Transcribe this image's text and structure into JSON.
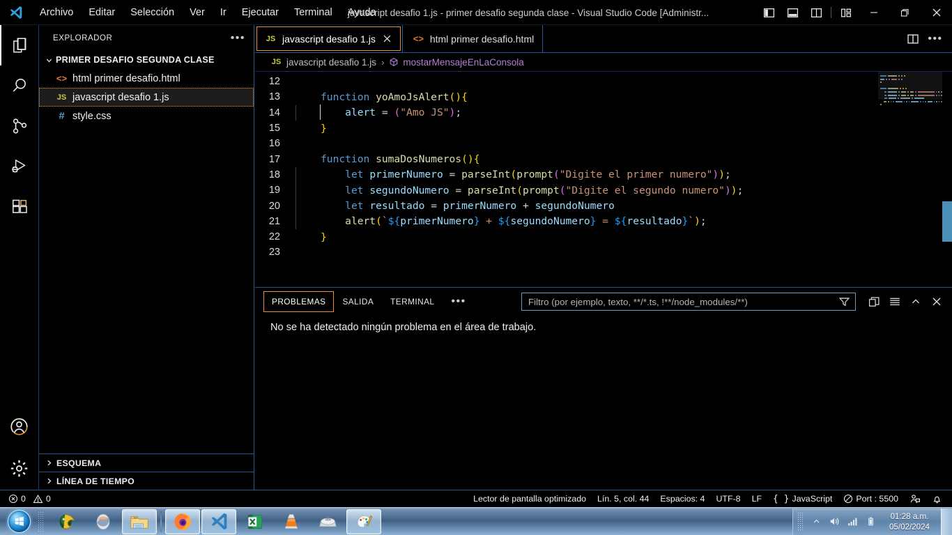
{
  "titlebar": {
    "logo_icon": "vscode-logo-icon",
    "menus": [
      "Archivo",
      "Editar",
      "Selección",
      "Ver",
      "Ir",
      "Ejecutar",
      "Terminal",
      "Ayuda"
    ],
    "window_title": "javascript desafio 1.js - primer desafio segunda clase - Visual Studio Code [Administr...",
    "layout_buttons": [
      {
        "name": "toggle-primary-sidebar-icon"
      },
      {
        "name": "toggle-panel-icon"
      },
      {
        "name": "toggle-secondary-sidebar-icon"
      },
      {
        "name": "customize-layout-icon"
      }
    ],
    "window_controls": [
      {
        "name": "minimize-button",
        "glyph": "–"
      },
      {
        "name": "maximize-button",
        "glyph": "❐"
      },
      {
        "name": "close-button",
        "glyph": "✕"
      }
    ]
  },
  "activitybar": {
    "items": [
      {
        "name": "explorer",
        "icon": "files-icon",
        "active": true
      },
      {
        "name": "search",
        "icon": "search-icon",
        "active": false
      },
      {
        "name": "source-control",
        "icon": "source-control-icon",
        "active": false
      },
      {
        "name": "run-and-debug",
        "icon": "run-debug-icon",
        "active": false
      },
      {
        "name": "extensions",
        "icon": "extensions-icon",
        "active": false
      }
    ],
    "bottom": [
      {
        "name": "accounts",
        "icon": "account-icon",
        "badge_color": "#e8912d"
      },
      {
        "name": "manage-settings",
        "icon": "gear-icon"
      }
    ]
  },
  "sidebar": {
    "title": "EXPLORADOR",
    "more_actions_label": "•••",
    "folder": {
      "name": "PRIMER DESAFIO SEGUNDA CLASE",
      "expanded": true
    },
    "files": [
      {
        "label": "html primer desafio.html",
        "icon": "html-file-icon",
        "icon_glyph": "<>",
        "selected": false
      },
      {
        "label": "javascript desafio 1.js",
        "icon": "js-file-icon",
        "icon_glyph": "JS",
        "selected": true
      },
      {
        "label": "style.css",
        "icon": "css-file-icon",
        "icon_glyph": "#",
        "selected": false
      }
    ],
    "sections": [
      {
        "label": "ESQUEMA",
        "expanded": false
      },
      {
        "label": "LÍNEA DE TIEMPO",
        "expanded": false
      }
    ]
  },
  "editor": {
    "tabs": [
      {
        "label": "javascript desafio 1.js",
        "icon_glyph": "JS",
        "icon": "js-file-icon",
        "active": true,
        "has_close": true
      },
      {
        "label": "html primer desafio.html",
        "icon_glyph": "<>",
        "icon": "html-file-icon",
        "active": false,
        "has_close": false
      }
    ],
    "tab_actions": [
      {
        "name": "split-editor-icon"
      },
      {
        "name": "more-actions-icon",
        "glyph": "•••"
      }
    ],
    "breadcrumb": [
      {
        "label": "javascript desafio 1.js",
        "icon": "js-file-icon",
        "icon_glyph": "JS"
      },
      {
        "label": "mostarMensajeEnLaConsola",
        "icon": "symbol-method-icon"
      }
    ],
    "first_line_number": 12,
    "lines": [
      {
        "n": 12,
        "guide": false,
        "tokens": []
      },
      {
        "n": 13,
        "guide": false,
        "tokens": [
          {
            "t": "function ",
            "c": "kw"
          },
          {
            "t": "yoAmoJsAlert",
            "c": "fn"
          },
          {
            "t": "(",
            "c": "pun"
          },
          {
            "t": ")",
            "c": "pun"
          },
          {
            "t": "{",
            "c": "pun"
          }
        ]
      },
      {
        "n": 14,
        "guide": true,
        "tokens": [
          {
            "t": "    alert ",
            "c": "var"
          },
          {
            "t": "= ",
            "c": "op"
          },
          {
            "t": "(",
            "c": "pun2"
          },
          {
            "t": "\"Amo JS\"",
            "c": "str"
          },
          {
            "t": ")",
            "c": "pun2"
          },
          {
            "t": ";",
            "c": "plain"
          }
        ]
      },
      {
        "n": 15,
        "guide": false,
        "tokens": [
          {
            "t": "}",
            "c": "pun"
          }
        ]
      },
      {
        "n": 16,
        "guide": false,
        "tokens": []
      },
      {
        "n": 17,
        "guide": false,
        "tokens": [
          {
            "t": "function ",
            "c": "kw"
          },
          {
            "t": "sumaDosNumeros",
            "c": "fn"
          },
          {
            "t": "(",
            "c": "pun"
          },
          {
            "t": ")",
            "c": "pun"
          },
          {
            "t": "{",
            "c": "pun"
          }
        ]
      },
      {
        "n": 18,
        "guide": true,
        "tokens": [
          {
            "t": "    ",
            "c": "plain"
          },
          {
            "t": "let ",
            "c": "kw"
          },
          {
            "t": "primerNumero ",
            "c": "var"
          },
          {
            "t": "= ",
            "c": "op"
          },
          {
            "t": "parseInt",
            "c": "fn"
          },
          {
            "t": "(",
            "c": "pun"
          },
          {
            "t": "prompt",
            "c": "fn"
          },
          {
            "t": "(",
            "c": "pun2"
          },
          {
            "t": "\"Digite el primer numero\"",
            "c": "str"
          },
          {
            "t": ")",
            "c": "pun2"
          },
          {
            "t": ")",
            "c": "pun"
          },
          {
            "t": ";",
            "c": "plain"
          }
        ]
      },
      {
        "n": 19,
        "guide": true,
        "tokens": [
          {
            "t": "    ",
            "c": "plain"
          },
          {
            "t": "let ",
            "c": "kw"
          },
          {
            "t": "segundoNumero ",
            "c": "var"
          },
          {
            "t": "= ",
            "c": "op"
          },
          {
            "t": "parseInt",
            "c": "fn"
          },
          {
            "t": "(",
            "c": "pun"
          },
          {
            "t": "prompt",
            "c": "fn"
          },
          {
            "t": "(",
            "c": "pun2"
          },
          {
            "t": "\"Digite el segundo numero\"",
            "c": "str"
          },
          {
            "t": ")",
            "c": "pun2"
          },
          {
            "t": ")",
            "c": "pun"
          },
          {
            "t": ";",
            "c": "plain"
          }
        ]
      },
      {
        "n": 20,
        "guide": true,
        "tokens": [
          {
            "t": "    ",
            "c": "plain"
          },
          {
            "t": "let ",
            "c": "kw"
          },
          {
            "t": "resultado ",
            "c": "var"
          },
          {
            "t": "= ",
            "c": "op"
          },
          {
            "t": "primerNumero ",
            "c": "var"
          },
          {
            "t": "+ ",
            "c": "op"
          },
          {
            "t": "segundoNumero",
            "c": "var"
          }
        ]
      },
      {
        "n": 21,
        "guide": true,
        "tokens": [
          {
            "t": "    ",
            "c": "plain"
          },
          {
            "t": "alert",
            "c": "fn"
          },
          {
            "t": "(",
            "c": "pun"
          },
          {
            "t": "`",
            "c": "str"
          },
          {
            "t": "${",
            "c": "pun3"
          },
          {
            "t": "primerNumero",
            "c": "var"
          },
          {
            "t": "}",
            "c": "pun3"
          },
          {
            "t": " + ",
            "c": "str"
          },
          {
            "t": "${",
            "c": "pun3"
          },
          {
            "t": "segundoNumero",
            "c": "var"
          },
          {
            "t": "}",
            "c": "pun3"
          },
          {
            "t": " = ",
            "c": "str"
          },
          {
            "t": "${",
            "c": "pun3"
          },
          {
            "t": "resultado",
            "c": "var"
          },
          {
            "t": "}",
            "c": "pun3"
          },
          {
            "t": "`",
            "c": "str"
          },
          {
            "t": ")",
            "c": "pun"
          },
          {
            "t": ";",
            "c": "plain"
          }
        ]
      },
      {
        "n": 22,
        "guide": false,
        "tokens": [
          {
            "t": "}",
            "c": "pun"
          }
        ]
      },
      {
        "n": 23,
        "guide": false,
        "tokens": []
      }
    ],
    "minimap": {
      "visible": true,
      "slider_on_top": true
    },
    "scrollbar": {
      "thumb_color": "#4a90b8"
    }
  },
  "panel": {
    "tabs": [
      {
        "label": "PROBLEMAS",
        "active": true
      },
      {
        "label": "SALIDA",
        "active": false
      },
      {
        "label": "TERMINAL",
        "active": false
      }
    ],
    "more_tabs_label": "•••",
    "filter": {
      "value": "",
      "placeholder": "Filtro (por ejemplo, texto, **/*.ts, !**/node_modules/**)",
      "icon": "filter-icon"
    },
    "actions": [
      {
        "name": "split-panel-icon"
      },
      {
        "name": "view-as-list-icon"
      },
      {
        "name": "collapse-panel-icon",
        "glyph": "^"
      },
      {
        "name": "close-panel-icon",
        "glyph": "✕"
      }
    ],
    "message": "No se ha detectado ningún problema en el área de trabajo."
  },
  "statusbar": {
    "errors": "0",
    "warnings": "0",
    "errors_icon": "error-circle-icon",
    "warnings_icon": "warning-triangle-icon",
    "items": [
      {
        "label": "Lector de pantalla optimizado",
        "name": "screen-reader-status"
      },
      {
        "label": "Lín. 5, col. 44",
        "name": "cursor-position-status"
      },
      {
        "label": "Espacios: 4",
        "name": "indentation-status"
      },
      {
        "label": "UTF-8",
        "name": "encoding-status"
      },
      {
        "label": "LF",
        "name": "eol-status"
      },
      {
        "label": "JavaScript",
        "name": "language-mode-status",
        "icon": "braces-icon"
      },
      {
        "label": "Port : 5500",
        "name": "live-server-status",
        "icon": "circle-slash-icon"
      }
    ],
    "right_icons": [
      {
        "name": "feedback-icon"
      },
      {
        "name": "bell-icon"
      }
    ]
  },
  "taskbar": {
    "start_label": "Iniciar",
    "items": [
      {
        "name": "taskbar-item-winrar",
        "icon": "winrar-icon",
        "active": false
      },
      {
        "name": "taskbar-item-media",
        "icon": "media-icon",
        "active": false
      },
      {
        "name": "taskbar-item-explorer",
        "icon": "folder-icon",
        "active": true
      },
      {
        "name": "taskbar-item-firefox",
        "icon": "firefox-icon",
        "active": true
      },
      {
        "name": "taskbar-item-vscode",
        "icon": "vscode-icon",
        "active": true
      },
      {
        "name": "taskbar-item-excel",
        "icon": "excel-icon",
        "active": false
      },
      {
        "name": "taskbar-item-vlc",
        "icon": "vlc-icon",
        "active": false
      },
      {
        "name": "taskbar-item-usb",
        "icon": "usb-drive-icon",
        "active": false
      },
      {
        "name": "taskbar-item-paint",
        "icon": "paint-icon",
        "active": true
      }
    ],
    "tray": [
      {
        "name": "show-hidden-icons",
        "icon": "chevron-up-icon"
      },
      {
        "name": "volume-icon",
        "icon": "speaker-icon"
      },
      {
        "name": "network-icon",
        "icon": "signal-bars-icon"
      },
      {
        "name": "battery-icon",
        "icon": "battery-icon"
      }
    ],
    "clock": {
      "time": "01:28 a.m.",
      "date": "05/02/2024"
    }
  },
  "colors": {
    "accent_focus": "#e8912d",
    "border_blue": "#3794ff",
    "scrollbar": "#4a90b8",
    "keyword": "#569cd6",
    "function": "#dcdcaa",
    "string": "#ce9178",
    "variable": "#9cdcfe",
    "punctuation_yellow": "#ffd700",
    "punctuation_magenta": "#da70d6",
    "punctuation_blue": "#179fff"
  }
}
